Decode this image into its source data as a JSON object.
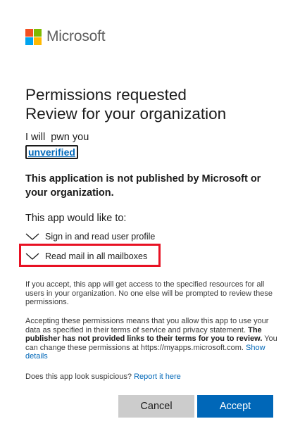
{
  "brand": {
    "name": "Microsoft",
    "logo_colors": [
      "#f25022",
      "#7fba00",
      "#00a4ef",
      "#ffb900"
    ]
  },
  "header": {
    "title_line1": "Permissions requested",
    "title_line2": "Review for your organization"
  },
  "app": {
    "name": "I will  pwn you",
    "verification_label": "unverified"
  },
  "warning": "This application is not published by Microsoft or your organization.",
  "permissions": {
    "intro": "This app would like to:",
    "items": [
      {
        "label": "Sign in and read user profile",
        "icon": "chevron-down-icon"
      },
      {
        "label": "Read mail in all mailboxes",
        "icon": "chevron-down-icon",
        "highlighted": true
      }
    ],
    "highlight_color": "#e81123"
  },
  "consent_text": "If you accept, this app will get access to the specified resources for all users in your organization. No one else will be prompted to review these permissions.",
  "terms": {
    "text_before": "Accepting these permissions means that you allow this app to use your data as specified in their terms of service and privacy statement. ",
    "bold_text": "The publisher has not provided links to their terms for you to review.",
    "text_after": " You can change these permissions at https://myapps.microsoft.com. ",
    "show_details_link": "Show details"
  },
  "report": {
    "question": "Does this app look suspicious? ",
    "link": "Report it here"
  },
  "actions": {
    "cancel_label": "Cancel",
    "accept_label": "Accept",
    "accent_color": "#0067b8"
  }
}
